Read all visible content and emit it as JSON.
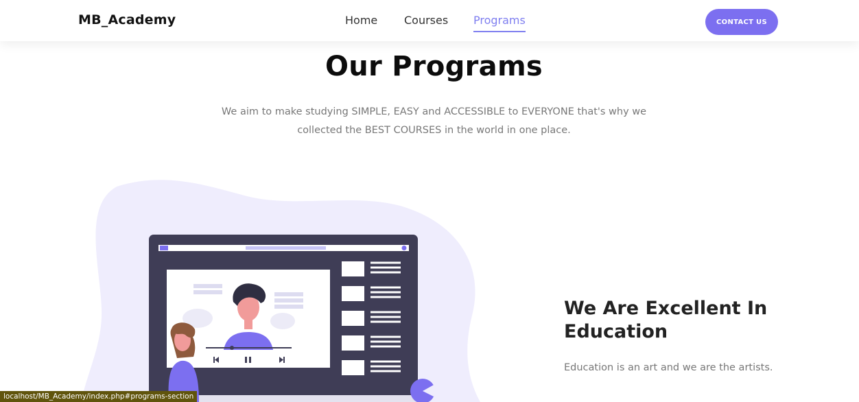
{
  "brand": "MB_Academy",
  "nav": {
    "items": [
      "Home",
      "Courses",
      "Programs"
    ],
    "active": "Programs"
  },
  "contact_button": "CONTACT US",
  "section": {
    "title": "Our Programs",
    "subtitle": "We aim to make studying SIMPLE, EASY and ACCESSIBLE to EVERYONE that's why we collected the BEST COURSES in the world in one place."
  },
  "feature": {
    "heading": "We Are Excellent In Education",
    "text": "Education is an art and we are the artists."
  },
  "status_bar_url": "localhost/MB_Academy/index.php#programs-section",
  "colors": {
    "accent": "#7c6ff0",
    "blob": "#efedfd",
    "laptop": "#3f3d56"
  }
}
